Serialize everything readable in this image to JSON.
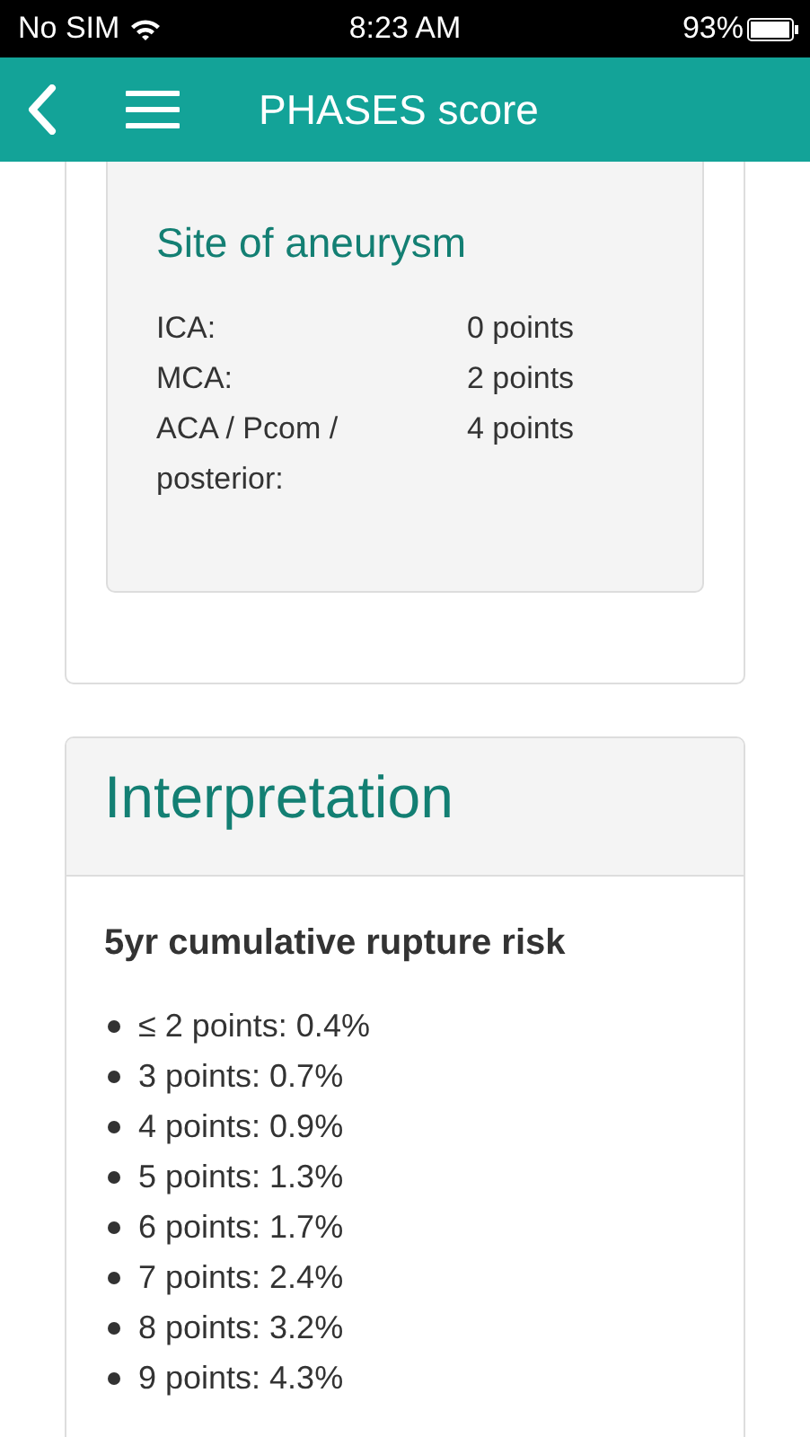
{
  "status_bar": {
    "carrier": "No SIM",
    "time": "8:23 AM",
    "battery": "93%"
  },
  "header": {
    "title": "PHASES score"
  },
  "site_box": {
    "title": "Site of aneurysm",
    "rows": [
      {
        "label": "ICA:",
        "value": "0 points"
      },
      {
        "label": "MCA:",
        "value": "2 points"
      },
      {
        "label": "ACA / Pcom / posterior:",
        "value": "4 points"
      }
    ]
  },
  "interpretation": {
    "title": "Interpretation",
    "subtitle": "5yr cumulative rupture risk",
    "items": [
      "≤ 2 points: 0.4%",
      "3 points: 0.7%",
      "4 points: 0.9%",
      "5 points: 1.3%",
      "6 points: 1.7%",
      "7 points: 2.4%",
      "8 points: 3.2%",
      "9 points: 4.3%"
    ]
  }
}
